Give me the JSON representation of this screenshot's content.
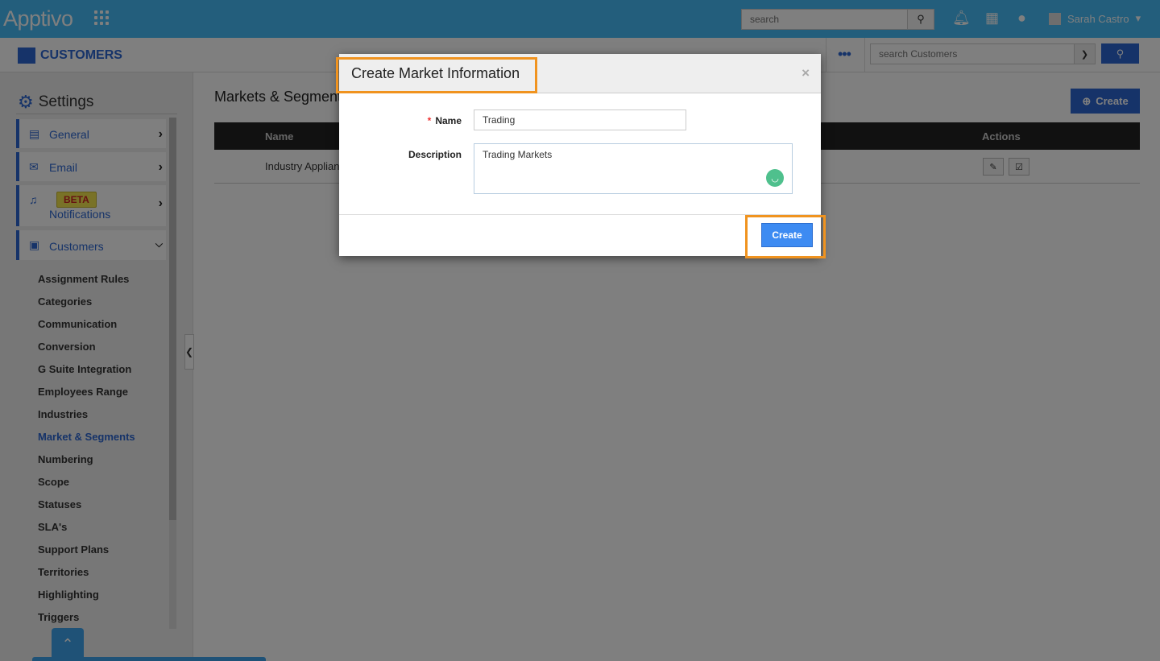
{
  "topbar": {
    "logo": "Apptivo",
    "search_placeholder": "search",
    "user_name": "Sarah Castro"
  },
  "subbar": {
    "app_title": "CUSTOMERS",
    "search_placeholder": "search Customers",
    "more": "•••"
  },
  "sidebar": {
    "heading": "Settings",
    "sections": [
      {
        "label": "General"
      },
      {
        "label": "Email"
      },
      {
        "label": "Notifications",
        "badge": "BETA"
      },
      {
        "label": "Customers"
      }
    ],
    "subitems": [
      "Assignment Rules",
      "Categories",
      "Communication",
      "Conversion",
      "G Suite Integration",
      "Employees Range",
      "Industries",
      "Market & Segments",
      "Numbering",
      "Scope",
      "Statuses",
      "SLA's",
      "Support Plans",
      "Territories",
      "Highlighting",
      "Triggers"
    ],
    "active": "Market & Segments"
  },
  "main": {
    "title": "Markets & Segments",
    "create_label": "Create",
    "columns": [
      "Name",
      "Actions"
    ],
    "rows": [
      {
        "name": "Industry Appliances"
      }
    ]
  },
  "modal": {
    "title": "Create Market Information",
    "name_label": "Name",
    "name_value": "Trading",
    "description_label": "Description",
    "description_value": "Trading Markets",
    "create_label": "Create",
    "close": "×"
  },
  "colors": {
    "accent": "#2c67d2",
    "header": "#46bcf8",
    "highlight": "#f0931f"
  }
}
